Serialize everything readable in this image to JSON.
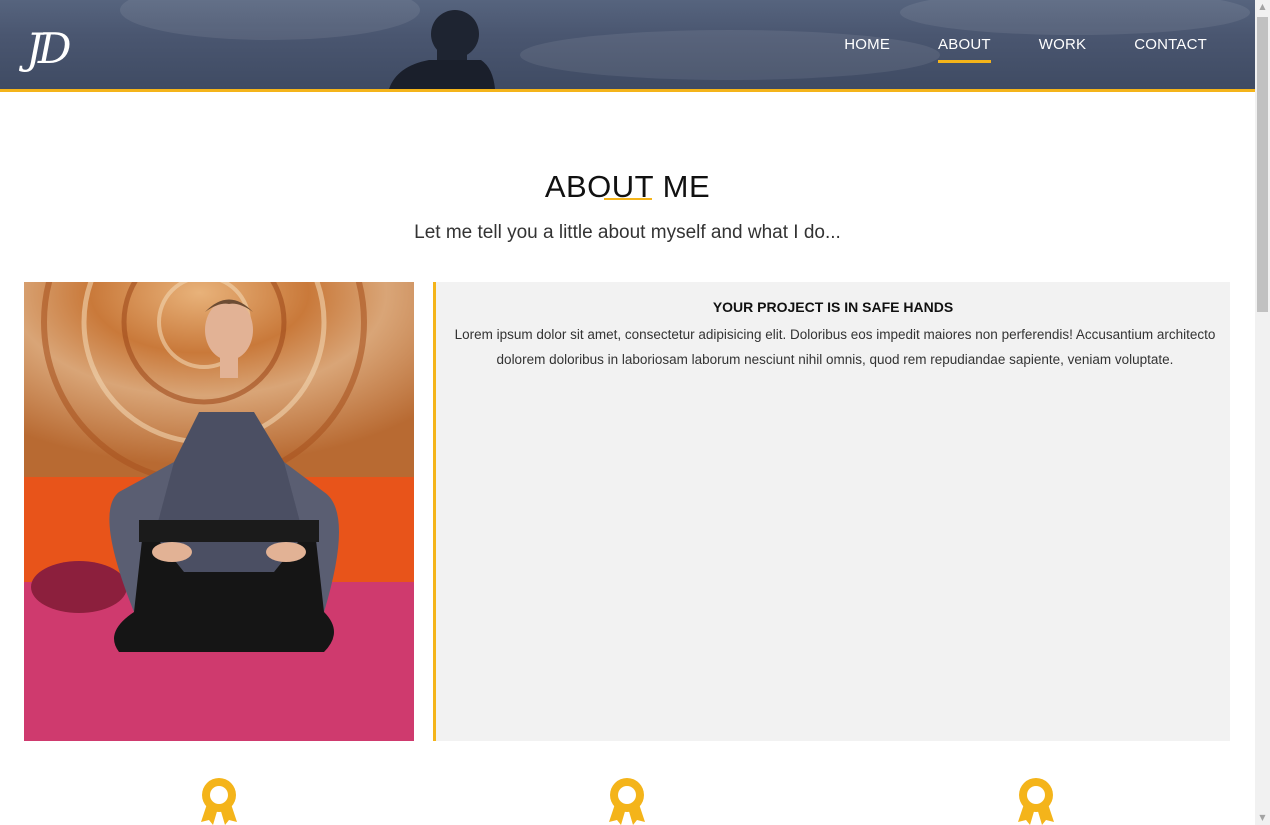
{
  "header": {
    "logo_text": "JD",
    "nav": [
      {
        "label": "HOME",
        "active": false
      },
      {
        "label": "ABOUT",
        "active": true
      },
      {
        "label": "WORK",
        "active": false
      },
      {
        "label": "CONTACT",
        "active": false
      }
    ]
  },
  "about": {
    "title": "ABOUT ME",
    "subtitle": "Let me tell you a little about myself and what I do...",
    "photo": "portrait-kneeling-in-kimono",
    "info_heading": "YOUR PROJECT IS IN SAFE HANDS",
    "info_text": "Lorem ipsum dolor sit amet, consectetur adipisicing elit. Doloribus eos impedit maiores non perferendis! Accusantium architecto dolorem doloribus in laboriosam laborum nesciunt nihil omnis, quod rem repudiandae sapiente, veniam voluptate."
  },
  "awards": [
    {
      "icon": "award-ribbon-icon"
    },
    {
      "icon": "award-ribbon-icon"
    },
    {
      "icon": "award-ribbon-icon"
    }
  ],
  "colors": {
    "accent": "#f4b41a",
    "header_bg": "#4a5670",
    "info_bg": "#f2f2f2"
  }
}
